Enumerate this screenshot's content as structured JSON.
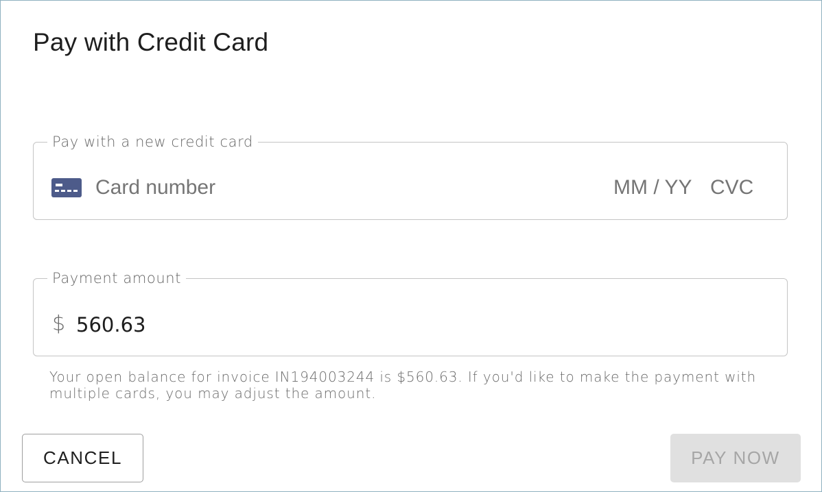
{
  "dialog": {
    "title": "Pay with Credit Card"
  },
  "card_field": {
    "legend": "Pay with a new credit card",
    "card_icon": "credit-card-icon",
    "card_number_placeholder": "Card number",
    "card_number_value": "",
    "expiry_placeholder": "MM / YY",
    "expiry_value": "",
    "cvc_placeholder": "CVC",
    "cvc_value": ""
  },
  "amount_field": {
    "legend": "Payment amount",
    "currency_symbol": "$",
    "value": "560.63"
  },
  "helper_text": "Your open balance for invoice IN194003244 is $560.63. If you'd like to make the payment with multiple cards, you may adjust the amount.",
  "actions": {
    "cancel_label": "CANCEL",
    "pay_label": "PAY NOW",
    "pay_disabled": true
  },
  "colors": {
    "card_icon": "#4d5b8a",
    "pay_button_bg": "#e0e0e0",
    "pay_button_text": "#a6a6a6",
    "border": "#c4c4c4"
  }
}
